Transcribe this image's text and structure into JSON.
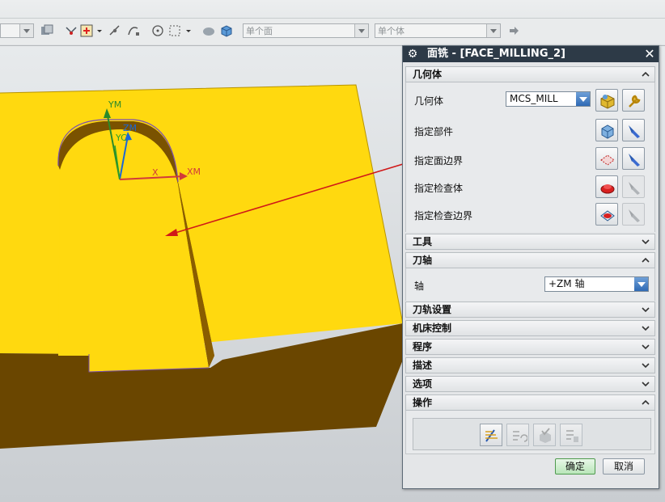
{
  "toolbar": {
    "combo_face": "单个面",
    "combo_body": "单个体"
  },
  "viewport": {
    "axis_ym": "YM",
    "axis_zm": "ZM",
    "axis_yc": "YC",
    "axis_xm": "XM",
    "axis_x": "X"
  },
  "dialog": {
    "title": "面铣 - [FACE_MILLING_2]",
    "sections": {
      "geometry": {
        "header": "几何体",
        "geometry_label": "几何体",
        "geometry_value": "MCS_MILL",
        "part_label": "指定部件",
        "face_boundary_label": "指定面边界",
        "check_body_label": "指定检查体",
        "check_boundary_label": "指定检查边界"
      },
      "tool": {
        "header": "工具"
      },
      "tool_axis": {
        "header": "刀轴",
        "axis_label": "轴",
        "axis_value": "+ZM 轴"
      },
      "path_settings": {
        "header": "刀轨设置"
      },
      "machine_control": {
        "header": "机床控制"
      },
      "program": {
        "header": "程序"
      },
      "description": {
        "header": "描述"
      },
      "options": {
        "header": "选项"
      },
      "actions": {
        "header": "操作"
      }
    },
    "ok_label": "确定",
    "cancel_label": "取消"
  }
}
